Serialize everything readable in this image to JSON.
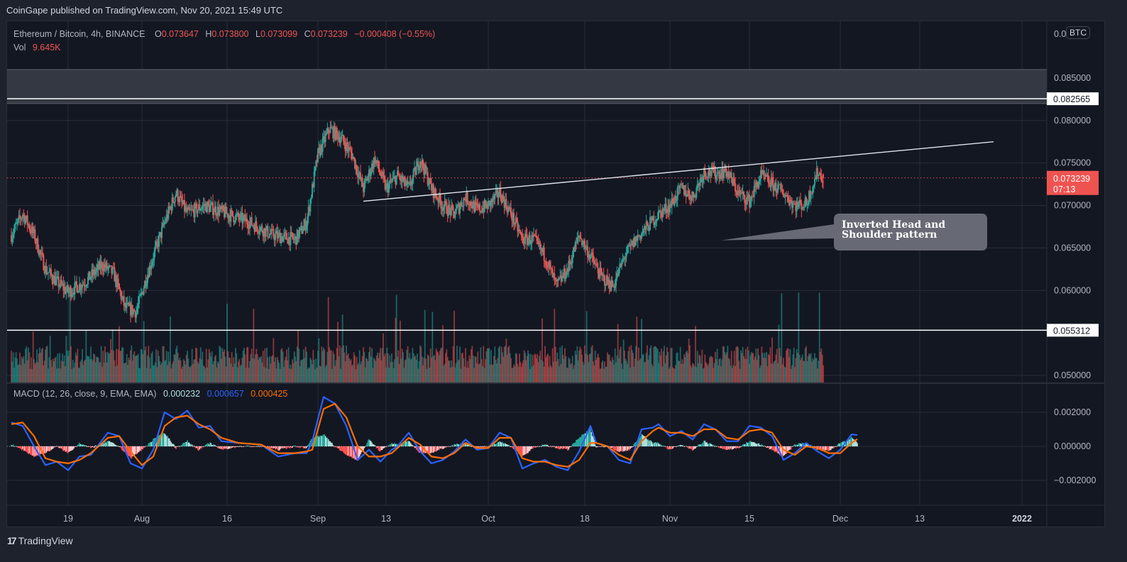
{
  "header": {
    "published": "CoinGape published on TradingView.com, Nov 20, 2021 15:49 UTC"
  },
  "legend": {
    "symbol": "Ethereum / Bitcoin, 4h, BINANCE",
    "open_label": "O",
    "open": "0.073647",
    "high_label": "H",
    "high": "0.073800",
    "low_label": "L",
    "low": "0.073099",
    "close_label": "C",
    "close": "0.073239",
    "change": "−0.000408 (−0.55%)",
    "vol_label": "Vol",
    "vol": "9.645K"
  },
  "macd_legend": {
    "label": "MACD (12, 26, close, 9, EMA, EMA)",
    "histogram": "0.000232",
    "macd": "0.000657",
    "signal": "0.000425"
  },
  "annotation": {
    "text_line1": "Inverted Head and",
    "text_line2": "Shoulder pattern"
  },
  "currency_badge": "BTC",
  "current_price": {
    "value": "0.073239",
    "countdown": "07:13"
  },
  "brand": {
    "name": "TradingView"
  },
  "colors": {
    "up": "#26a69a",
    "down": "#ef5350",
    "macd": "#2962ff",
    "signal": "#ff6d00",
    "hist_up_strong": "#26a69a",
    "hist_up_weak": "#b2dfdb",
    "hist_down_strong": "#ff5252",
    "hist_down_weak": "#ffcdd2",
    "annotation_bg": "#676a74",
    "background": "#131722"
  },
  "chart_data": {
    "type": "candlestick",
    "title": "Ethereum / Bitcoin, 4h, BINANCE",
    "price_axis": {
      "ticks": [
        "0.085000",
        "0.080000",
        "0.075000",
        "0.070000",
        "0.065000",
        "0.060000",
        "0.050000"
      ],
      "tick_values": [
        0.085,
        0.08,
        0.075,
        0.07,
        0.065,
        0.06,
        0.05
      ],
      "top_label_partial": "0.0",
      "range": [
        0.0495,
        0.0905
      ]
    },
    "time_axis": {
      "ticks": [
        "19",
        "Aug",
        "16",
        "Sep",
        "13",
        "Oct",
        "18",
        "Nov",
        "15",
        "Dec",
        "13",
        "2022"
      ],
      "tick_days": [
        0,
        13,
        28,
        44,
        56,
        74,
        91,
        106,
        120,
        136,
        150,
        168
      ],
      "range_days": [
        -10,
        172
      ],
      "start_date": "2021-07-19"
    },
    "horizontal_levels": [
      {
        "value": 0.082565,
        "label": "0.082565",
        "style": "white-line"
      },
      {
        "value": 0.055312,
        "label": "0.055312",
        "style": "white-line"
      }
    ],
    "resistance_zone": {
      "from": 0.082,
      "to": 0.086
    },
    "current_price_line": 0.073239,
    "trendlines": [
      {
        "name": "neckline",
        "from": {
          "day": 52,
          "price": 0.0705
        },
        "to": {
          "day": 163,
          "price": 0.0775
        }
      }
    ],
    "annotation_pointer": {
      "day": 115,
      "price": 0.0659
    },
    "price_path_keypoints": [
      {
        "day": -10,
        "price": 0.0665
      },
      {
        "day": -8,
        "price": 0.069
      },
      {
        "day": -6,
        "price": 0.0665
      },
      {
        "day": -4,
        "price": 0.0625
      },
      {
        "day": -2,
        "price": 0.061
      },
      {
        "day": 0,
        "price": 0.0598
      },
      {
        "day": 3,
        "price": 0.061
      },
      {
        "day": 6,
        "price": 0.063
      },
      {
        "day": 8,
        "price": 0.062
      },
      {
        "day": 10,
        "price": 0.058
      },
      {
        "day": 12,
        "price": 0.0575
      },
      {
        "day": 14,
        "price": 0.062
      },
      {
        "day": 17,
        "price": 0.068
      },
      {
        "day": 19,
        "price": 0.0715
      },
      {
        "day": 21,
        "price": 0.069
      },
      {
        "day": 24,
        "price": 0.07
      },
      {
        "day": 28,
        "price": 0.069
      },
      {
        "day": 32,
        "price": 0.068
      },
      {
        "day": 36,
        "price": 0.0665
      },
      {
        "day": 40,
        "price": 0.066
      },
      {
        "day": 42,
        "price": 0.068
      },
      {
        "day": 44,
        "price": 0.076
      },
      {
        "day": 46,
        "price": 0.079
      },
      {
        "day": 48,
        "price": 0.078
      },
      {
        "day": 50,
        "price": 0.076
      },
      {
        "day": 52,
        "price": 0.072
      },
      {
        "day": 54,
        "price": 0.0755
      },
      {
        "day": 56,
        "price": 0.072
      },
      {
        "day": 58,
        "price": 0.0735
      },
      {
        "day": 60,
        "price": 0.072
      },
      {
        "day": 62,
        "price": 0.0755
      },
      {
        "day": 64,
        "price": 0.072
      },
      {
        "day": 66,
        "price": 0.07
      },
      {
        "day": 68,
        "price": 0.069
      },
      {
        "day": 70,
        "price": 0.071
      },
      {
        "day": 72,
        "price": 0.0695
      },
      {
        "day": 74,
        "price": 0.07
      },
      {
        "day": 76,
        "price": 0.0715
      },
      {
        "day": 78,
        "price": 0.069
      },
      {
        "day": 80,
        "price": 0.066
      },
      {
        "day": 82,
        "price": 0.066
      },
      {
        "day": 84,
        "price": 0.064
      },
      {
        "day": 86,
        "price": 0.0605
      },
      {
        "day": 88,
        "price": 0.0625
      },
      {
        "day": 90,
        "price": 0.0665
      },
      {
        "day": 92,
        "price": 0.064
      },
      {
        "day": 94,
        "price": 0.0615
      },
      {
        "day": 96,
        "price": 0.0605
      },
      {
        "day": 98,
        "price": 0.064
      },
      {
        "day": 100,
        "price": 0.066
      },
      {
        "day": 102,
        "price": 0.0675
      },
      {
        "day": 104,
        "price": 0.069
      },
      {
        "day": 106,
        "price": 0.07
      },
      {
        "day": 108,
        "price": 0.072
      },
      {
        "day": 110,
        "price": 0.071
      },
      {
        "day": 112,
        "price": 0.074
      },
      {
        "day": 114,
        "price": 0.0738
      },
      {
        "day": 116,
        "price": 0.074
      },
      {
        "day": 118,
        "price": 0.0715
      },
      {
        "day": 120,
        "price": 0.0705
      },
      {
        "day": 122,
        "price": 0.0735
      },
      {
        "day": 124,
        "price": 0.0725
      },
      {
        "day": 126,
        "price": 0.0715
      },
      {
        "day": 128,
        "price": 0.07
      },
      {
        "day": 130,
        "price": 0.0702
      },
      {
        "day": 132,
        "price": 0.074
      },
      {
        "day": 133,
        "price": 0.0732
      }
    ],
    "macd_axis": {
      "ticks": [
        "0.002000",
        "0.000000",
        "−0.002000"
      ],
      "tick_values": [
        0.002,
        0,
        -0.002
      ],
      "range": [
        -0.0035,
        0.0033
      ]
    },
    "macd_keypoints": [
      {
        "day": -10,
        "price": 0.0014
      },
      {
        "day": -8,
        "price": 0.0012
      },
      {
        "day": -6,
        "price": 0.0
      },
      {
        "day": -4,
        "price": -0.0011
      },
      {
        "day": -2,
        "price": -0.0009
      },
      {
        "day": 0,
        "price": -0.0014
      },
      {
        "day": 2,
        "price": -0.0006
      },
      {
        "day": 4,
        "price": -0.0005
      },
      {
        "day": 7,
        "price": 0.0008
      },
      {
        "day": 9,
        "price": 0.0006
      },
      {
        "day": 11,
        "price": -0.001
      },
      {
        "day": 13,
        "price": -0.0013
      },
      {
        "day": 15,
        "price": -0.0002
      },
      {
        "day": 17,
        "price": 0.002
      },
      {
        "day": 19,
        "price": 0.0016
      },
      {
        "day": 21,
        "price": 0.0021
      },
      {
        "day": 23,
        "price": 0.0011
      },
      {
        "day": 25,
        "price": 0.0012
      },
      {
        "day": 27,
        "price": 0.0003
      },
      {
        "day": 30,
        "price": 0.0002
      },
      {
        "day": 34,
        "price": 0.0001
      },
      {
        "day": 37,
        "price": -0.0006
      },
      {
        "day": 40,
        "price": -0.0004
      },
      {
        "day": 42,
        "price": -0.0004
      },
      {
        "day": 43,
        "price": 0.0003
      },
      {
        "day": 45,
        "price": 0.0029
      },
      {
        "day": 47,
        "price": 0.0025
      },
      {
        "day": 49,
        "price": 0.0012
      },
      {
        "day": 51,
        "price": -0.0008
      },
      {
        "day": 53,
        "price": -0.0002
      },
      {
        "day": 55,
        "price": -0.0009
      },
      {
        "day": 57,
        "price": -0.0002
      },
      {
        "day": 58,
        "price": 0.0
      },
      {
        "day": 60,
        "price": 0.0008
      },
      {
        "day": 62,
        "price": -0.0003
      },
      {
        "day": 64,
        "price": -0.001
      },
      {
        "day": 66,
        "price": -0.0008
      },
      {
        "day": 68,
        "price": -0.0003
      },
      {
        "day": 70,
        "price": 0.0004
      },
      {
        "day": 72,
        "price": -0.0002
      },
      {
        "day": 74,
        "price": -0.0001
      },
      {
        "day": 76,
        "price": 0.0008
      },
      {
        "day": 78,
        "price": 0.0005
      },
      {
        "day": 80,
        "price": -0.0013
      },
      {
        "day": 82,
        "price": -0.001
      },
      {
        "day": 84,
        "price": -0.0008
      },
      {
        "day": 86,
        "price": -0.0012
      },
      {
        "day": 88,
        "price": -0.0014
      },
      {
        "day": 90,
        "price": -0.0003
      },
      {
        "day": 92,
        "price": 0.0012
      },
      {
        "day": 93,
        "price": 0.0002
      },
      {
        "day": 95,
        "price": 0.0
      },
      {
        "day": 97,
        "price": -0.0008
      },
      {
        "day": 99,
        "price": -0.001
      },
      {
        "day": 101,
        "price": 0.001
      },
      {
        "day": 103,
        "price": 0.0011
      },
      {
        "day": 104,
        "price": 0.0013
      },
      {
        "day": 106,
        "price": 0.0006
      },
      {
        "day": 108,
        "price": 0.0009
      },
      {
        "day": 110,
        "price": 0.0004
      },
      {
        "day": 112,
        "price": 0.0013
      },
      {
        "day": 114,
        "price": 0.001
      },
      {
        "day": 116,
        "price": 0.0003
      },
      {
        "day": 118,
        "price": 0.0003
      },
      {
        "day": 120,
        "price": 0.0012
      },
      {
        "day": 122,
        "price": 0.0011
      },
      {
        "day": 124,
        "price": 0.0006
      },
      {
        "day": 126,
        "price": -0.0008
      },
      {
        "day": 128,
        "price": -0.0004
      },
      {
        "day": 130,
        "price": 0.0002
      },
      {
        "day": 132,
        "price": -0.0003
      },
      {
        "day": 134,
        "price": -0.0007
      },
      {
        "day": 136,
        "price": -0.0002
      },
      {
        "day": 138,
        "price": 0.0007
      },
      {
        "day": 139,
        "price": 0.000657
      }
    ],
    "signal_keypoints": [
      {
        "day": -10,
        "price": 0.0013
      },
      {
        "day": -8,
        "price": 0.0014
      },
      {
        "day": -6,
        "price": 0.0006
      },
      {
        "day": -4,
        "price": -0.0007
      },
      {
        "day": -2,
        "price": -0.0009
      },
      {
        "day": 0,
        "price": -0.001
      },
      {
        "day": 2,
        "price": -0.0008
      },
      {
        "day": 4,
        "price": -0.0004
      },
      {
        "day": 7,
        "price": 0.0005
      },
      {
        "day": 9,
        "price": 0.0006
      },
      {
        "day": 11,
        "price": -0.0003
      },
      {
        "day": 13,
        "price": -0.0011
      },
      {
        "day": 15,
        "price": -0.0006
      },
      {
        "day": 17,
        "price": 0.0012
      },
      {
        "day": 19,
        "price": 0.0017
      },
      {
        "day": 21,
        "price": 0.0018
      },
      {
        "day": 23,
        "price": 0.0013
      },
      {
        "day": 25,
        "price": 0.001
      },
      {
        "day": 27,
        "price": 0.0005
      },
      {
        "day": 30,
        "price": 0.0002
      },
      {
        "day": 34,
        "price": 0.0001
      },
      {
        "day": 37,
        "price": -0.0004
      },
      {
        "day": 40,
        "price": -0.0004
      },
      {
        "day": 42,
        "price": -0.0003
      },
      {
        "day": 43,
        "price": -0.0002
      },
      {
        "day": 45,
        "price": 0.0022
      },
      {
        "day": 47,
        "price": 0.0025
      },
      {
        "day": 49,
        "price": 0.0017
      },
      {
        "day": 51,
        "price": 0.0
      },
      {
        "day": 53,
        "price": -0.0006
      },
      {
        "day": 55,
        "price": -0.0006
      },
      {
        "day": 57,
        "price": -0.0004
      },
      {
        "day": 58,
        "price": -0.0001
      },
      {
        "day": 60,
        "price": 0.0005
      },
      {
        "day": 62,
        "price": 0.0001
      },
      {
        "day": 64,
        "price": -0.0006
      },
      {
        "day": 66,
        "price": -0.0007
      },
      {
        "day": 68,
        "price": -0.0004
      },
      {
        "day": 70,
        "price": 0.0002
      },
      {
        "day": 72,
        "price": -0.0001
      },
      {
        "day": 74,
        "price": -0.0001
      },
      {
        "day": 76,
        "price": 0.0005
      },
      {
        "day": 78,
        "price": 0.0005
      },
      {
        "day": 80,
        "price": -0.0007
      },
      {
        "day": 82,
        "price": -0.0009
      },
      {
        "day": 84,
        "price": -0.0009
      },
      {
        "day": 86,
        "price": -0.0011
      },
      {
        "day": 88,
        "price": -0.0012
      },
      {
        "day": 90,
        "price": -0.0008
      },
      {
        "day": 92,
        "price": 0.0002
      },
      {
        "day": 93,
        "price": 0.0002
      },
      {
        "day": 95,
        "price": 0.0
      },
      {
        "day": 97,
        "price": -0.0005
      },
      {
        "day": 99,
        "price": -0.0008
      },
      {
        "day": 101,
        "price": 0.0003
      },
      {
        "day": 103,
        "price": 0.0009
      },
      {
        "day": 104,
        "price": 0.0011
      },
      {
        "day": 106,
        "price": 0.0008
      },
      {
        "day": 108,
        "price": 0.0008
      },
      {
        "day": 110,
        "price": 0.0006
      },
      {
        "day": 112,
        "price": 0.001
      },
      {
        "day": 114,
        "price": 0.001
      },
      {
        "day": 116,
        "price": 0.0005
      },
      {
        "day": 118,
        "price": 0.0004
      },
      {
        "day": 120,
        "price": 0.0009
      },
      {
        "day": 122,
        "price": 0.001
      },
      {
        "day": 124,
        "price": 0.0008
      },
      {
        "day": 126,
        "price": -0.0002
      },
      {
        "day": 128,
        "price": -0.0005
      },
      {
        "day": 130,
        "price": 0.0
      },
      {
        "day": 132,
        "price": -0.0001
      },
      {
        "day": 134,
        "price": -0.0004
      },
      {
        "day": 136,
        "price": -0.0004
      },
      {
        "day": 138,
        "price": 0.0002
      },
      {
        "day": 139,
        "price": 0.000425
      }
    ]
  }
}
